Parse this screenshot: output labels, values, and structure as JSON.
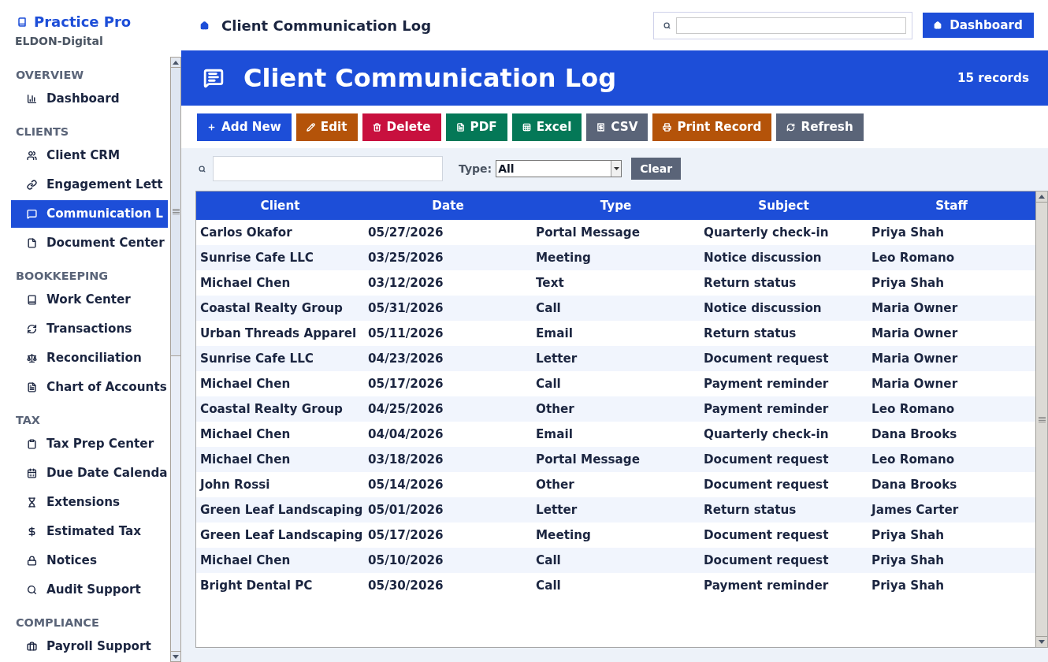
{
  "sidebar": {
    "brand": "Practice Pro",
    "org": "ELDON-Digital",
    "sections": [
      {
        "title": "OVERVIEW",
        "items": [
          {
            "label": "Dashboard",
            "selected": false
          }
        ]
      },
      {
        "title": "CLIENTS",
        "items": [
          {
            "label": "Client CRM",
            "selected": false
          },
          {
            "label": "Engagement Lett",
            "selected": false
          },
          {
            "label": "Communication L",
            "selected": true
          },
          {
            "label": "Document Center",
            "selected": false
          }
        ]
      },
      {
        "title": "BOOKKEEPING",
        "items": [
          {
            "label": "Work Center",
            "selected": false
          },
          {
            "label": "Transactions",
            "selected": false
          },
          {
            "label": "Reconciliation",
            "selected": false
          },
          {
            "label": "Chart of Accounts",
            "selected": false
          }
        ]
      },
      {
        "title": "TAX",
        "items": [
          {
            "label": "Tax Prep Center",
            "selected": false
          },
          {
            "label": "Due Date Calenda",
            "selected": false
          },
          {
            "label": "Extensions",
            "selected": false
          },
          {
            "label": "Estimated Tax",
            "selected": false
          },
          {
            "label": "Notices",
            "selected": false
          },
          {
            "label": "Audit Support",
            "selected": false
          }
        ]
      },
      {
        "title": "COMPLIANCE",
        "items": [
          {
            "label": "Payroll Support",
            "selected": false
          }
        ]
      }
    ]
  },
  "topbar": {
    "title": "Client Communication Log",
    "button": "Dashboard"
  },
  "banner": {
    "title": "Client Communication Log",
    "count": "15 records"
  },
  "toolbar": [
    {
      "label": "Add New",
      "kind": "add",
      "color": "#1d4ed8"
    },
    {
      "label": "Edit",
      "kind": "edit",
      "color": "#b45309"
    },
    {
      "label": "Delete",
      "kind": "delete",
      "color": "#c8103e"
    },
    {
      "label": "PDF",
      "kind": "pdf",
      "color": "#047857"
    },
    {
      "label": "Excel",
      "kind": "excel",
      "color": "#047857"
    },
    {
      "label": "CSV",
      "kind": "csv",
      "color": "#5a6478"
    },
    {
      "label": "Print Record",
      "kind": "print",
      "color": "#b45309"
    },
    {
      "label": "Refresh",
      "kind": "refresh",
      "color": "#5a6478"
    }
  ],
  "filters": {
    "type_label": "Type:",
    "type_value": "All",
    "clear": "Clear"
  },
  "table": {
    "columns": [
      "Client",
      "Date",
      "Type",
      "Subject",
      "Staff"
    ],
    "rows": [
      [
        "Carlos Okafor",
        "05/27/2026",
        "Portal Message",
        "Quarterly check-in",
        "Priya Shah"
      ],
      [
        "Sunrise Cafe LLC",
        "03/25/2026",
        "Meeting",
        "Notice discussion",
        "Leo Romano"
      ],
      [
        "Michael Chen",
        "03/12/2026",
        "Text",
        "Return status",
        "Priya Shah"
      ],
      [
        "Coastal Realty Group",
        "05/31/2026",
        "Call",
        "Notice discussion",
        "Maria Owner"
      ],
      [
        "Urban Threads Apparel",
        "05/11/2026",
        "Email",
        "Return status",
        "Maria Owner"
      ],
      [
        "Sunrise Cafe LLC",
        "04/23/2026",
        "Letter",
        "Document request",
        "Maria Owner"
      ],
      [
        "Michael Chen",
        "05/17/2026",
        "Call",
        "Payment reminder",
        "Maria Owner"
      ],
      [
        "Coastal Realty Group",
        "04/25/2026",
        "Other",
        "Payment reminder",
        "Leo Romano"
      ],
      [
        "Michael Chen",
        "04/04/2026",
        "Email",
        "Quarterly check-in",
        "Dana Brooks"
      ],
      [
        "Michael Chen",
        "03/18/2026",
        "Portal Message",
        "Document request",
        "Leo Romano"
      ],
      [
        "John Rossi",
        "05/14/2026",
        "Other",
        "Document request",
        "Dana Brooks"
      ],
      [
        "Green Leaf Landscaping",
        "05/01/2026",
        "Letter",
        "Return status",
        "James Carter"
      ],
      [
        "Green Leaf Landscaping",
        "05/17/2026",
        "Meeting",
        "Document request",
        "Priya Shah"
      ],
      [
        "Michael Chen",
        "05/10/2026",
        "Call",
        "Document request",
        "Priya Shah"
      ],
      [
        "Bright Dental PC",
        "05/30/2026",
        "Call",
        "Payment reminder",
        "Priya Shah"
      ]
    ]
  }
}
